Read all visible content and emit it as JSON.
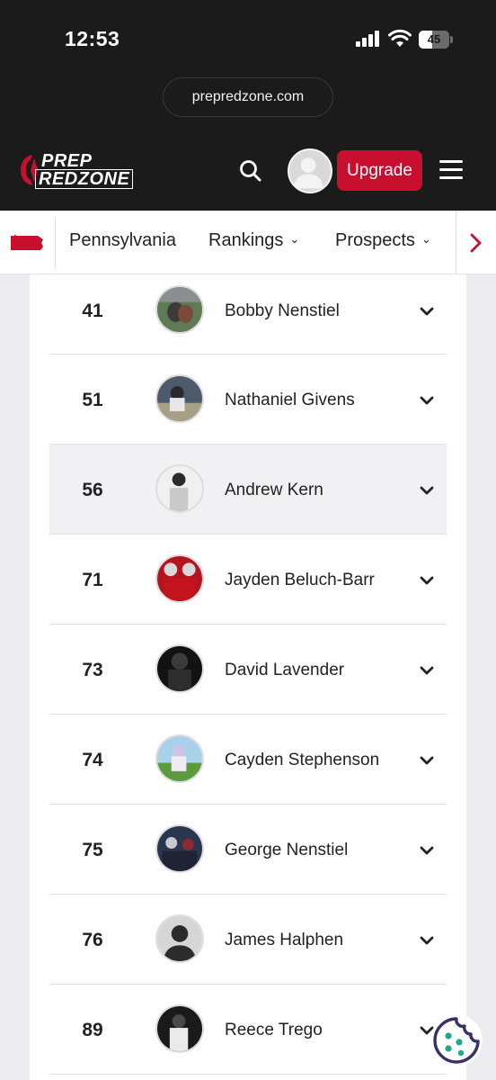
{
  "status_bar": {
    "time": "12:53",
    "battery_percent": "45",
    "battery_level": 0.45
  },
  "browser": {
    "url": "prepredzone.com"
  },
  "header": {
    "logo_line1": "PREP",
    "logo_line2": "REDZONE",
    "upgrade_label": "Upgrade",
    "brand_color": "#c8102e"
  },
  "sub_nav": {
    "state": "Pennsylvania",
    "rankings_label": "Rankings",
    "prospects_label": "Prospects"
  },
  "rankings": [
    {
      "rank": "41",
      "name": "Bobby Nenstiel"
    },
    {
      "rank": "51",
      "name": "Nathaniel Givens"
    },
    {
      "rank": "56",
      "name": "Andrew Kern"
    },
    {
      "rank": "71",
      "name": "Jayden Beluch-Barr"
    },
    {
      "rank": "73",
      "name": "David Lavender"
    },
    {
      "rank": "74",
      "name": "Cayden Stephenson"
    },
    {
      "rank": "75",
      "name": "George Nenstiel"
    },
    {
      "rank": "76",
      "name": "James Halphen"
    },
    {
      "rank": "89",
      "name": "Reece Trego"
    }
  ]
}
